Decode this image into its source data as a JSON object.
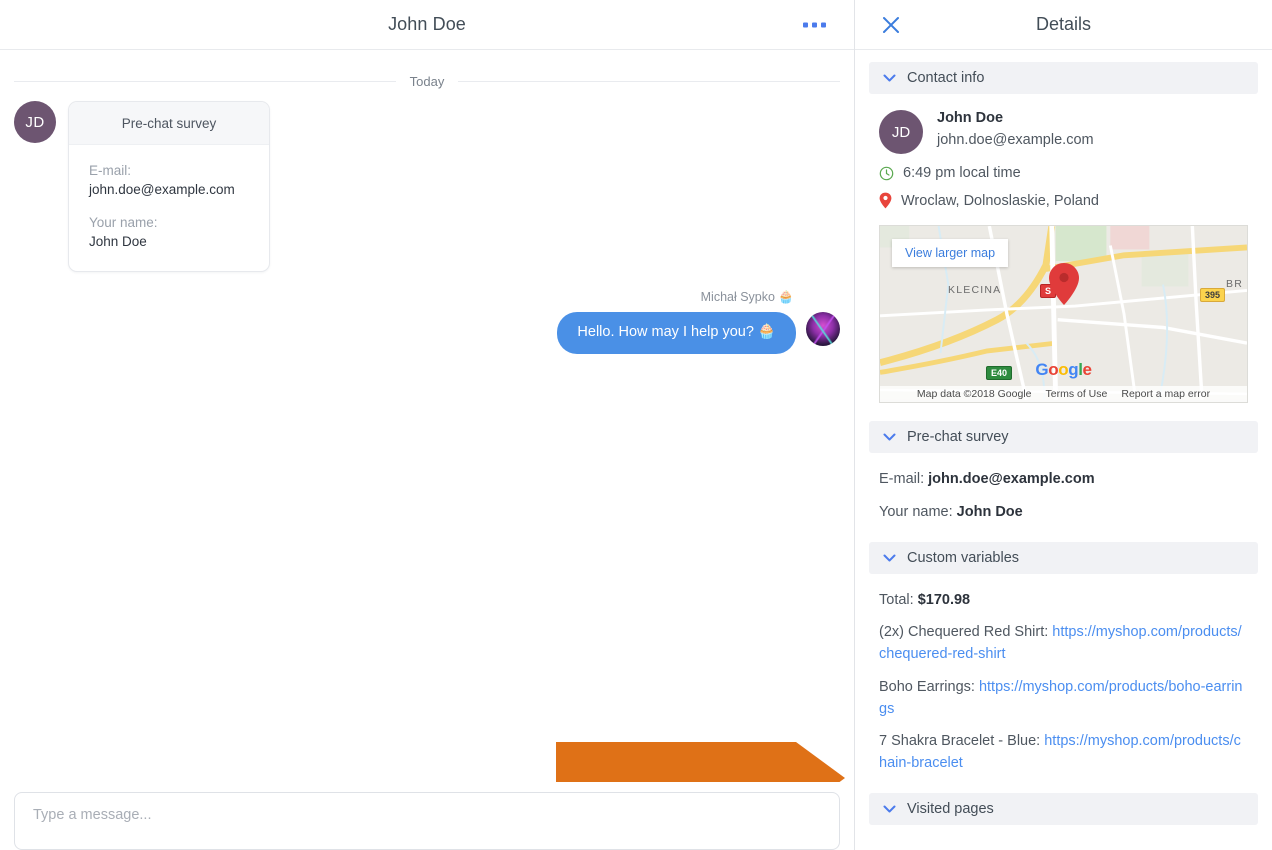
{
  "chat": {
    "header": {
      "title": "John Doe",
      "more_icon": "more-horizontal-icon"
    },
    "day_divider": "Today",
    "customer": {
      "avatar_initials": "JD",
      "survey_card": {
        "title": "Pre-chat survey",
        "fields": [
          {
            "label": "E-mail:",
            "value": "john.doe@example.com"
          },
          {
            "label": "Your name:",
            "value": "John Doe"
          }
        ]
      }
    },
    "agent": {
      "name": "Michał Sypko 🧁",
      "message": "Hello. How may I help you? 🧁"
    },
    "composer": {
      "placeholder": "Type a message..."
    }
  },
  "details": {
    "title": "Details",
    "close_icon": "close-icon",
    "sections": {
      "contact_info": {
        "heading": "Contact info",
        "chevron_icon": "chevron-down-icon",
        "avatar_initials": "JD",
        "name": "John Doe",
        "email": "john.doe@example.com",
        "local_time": "6:49 pm local time",
        "clock_icon": "clock-icon",
        "location": "Wroclaw, Dolnoslaskie, Poland",
        "pin_icon": "map-pin-icon",
        "map": {
          "view_larger": "View larger map",
          "logo": "Google",
          "attribution": "Map data ©2018 Google",
          "terms": "Terms of Use",
          "report": "Report a map error",
          "labels": [
            "KLECINA",
            "BR"
          ],
          "road_badges": [
            "S",
            "395",
            "E40"
          ]
        }
      },
      "pre_chat_survey": {
        "heading": "Pre-chat survey",
        "chevron_icon": "chevron-down-icon",
        "rows": [
          {
            "label": "E-mail:",
            "value": "john.doe@example.com"
          },
          {
            "label": "Your name:",
            "value": "John Doe"
          }
        ]
      },
      "custom_variables": {
        "heading": "Custom variables",
        "chevron_icon": "chevron-down-icon",
        "total_label": "Total:",
        "total_value": "$170.98",
        "items": [
          {
            "label": "(2x) Chequered Red Shirt:",
            "url": "https://myshop.com/products/chequered-red-shirt"
          },
          {
            "label": "Boho Earrings:",
            "url": "https://myshop.com/products/boho-earrings"
          },
          {
            "label": "7 Shakra Bracelet - Blue:",
            "url": "https://myshop.com/products/chain-bracelet"
          }
        ]
      },
      "visited_pages": {
        "heading": "Visited pages",
        "chevron_icon": "chevron-down-icon"
      }
    }
  },
  "annotation": {
    "type": "arrow-right",
    "color": "#df7117",
    "outline": "#ffffff"
  },
  "colors": {
    "accent_blue": "#4b7bec",
    "bubble_blue": "#4a90e6",
    "avatar_purple": "#6d5571",
    "link_blue": "#4b8ef0",
    "section_bg": "#f1f2f5",
    "pin_red": "#e8453c",
    "clock_green": "#5aa84f"
  }
}
